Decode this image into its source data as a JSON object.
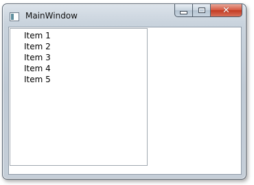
{
  "window": {
    "title": "MainWindow",
    "icon": "app-window-icon",
    "controls": {
      "minimize": "minimize-icon",
      "maximize": "maximize-icon",
      "close": "close-icon",
      "close_color": "#c23a22"
    }
  },
  "listbox": {
    "items": [
      {
        "label": "Item 1"
      },
      {
        "label": "Item 2"
      },
      {
        "label": "Item 3"
      },
      {
        "label": "Item 4"
      },
      {
        "label": "Item 5"
      }
    ]
  }
}
